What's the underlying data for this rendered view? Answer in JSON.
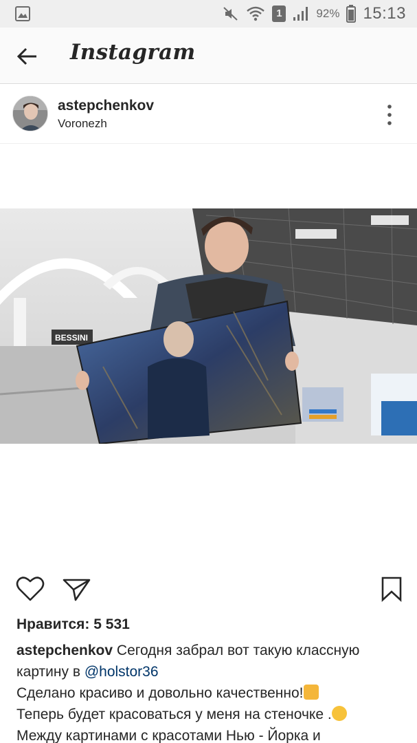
{
  "status_bar": {
    "battery_percent": "92%",
    "time": "15:13",
    "sim_badge": "1",
    "icons": [
      "gallery-notification-icon",
      "mute-icon",
      "wifi-icon",
      "sim-icon",
      "signal-icon",
      "battery-icon"
    ]
  },
  "header": {
    "title": "Instagram",
    "back_icon": "back-arrow-icon"
  },
  "post": {
    "username": "astepchenkov",
    "location": "Voronezh",
    "more_icon": "more-vertical-icon",
    "photo_store_sign": "BESSINI",
    "likes_label": "Нравится: 5 531",
    "caption": {
      "user": "astepchenkov",
      "line1_text": "Сегодня забрал вот такую классную",
      "line2_text": "картину в",
      "mention": "@holstor36",
      "line3_text": "Сделано красиво и довольно качественно!",
      "line3_emoji": "thumbs-up-emoji",
      "line4_text": "Теперь будет красоваться у меня на стеночке .",
      "line4_emoji": "smiling-face-emoji",
      "line5_text": "Между картинами с красотами Нью - Йорка и"
    },
    "action_icons": [
      "heart-icon",
      "share-icon",
      "bookmark-icon"
    ]
  },
  "colors": {
    "status_bar_bg": "#efefef",
    "header_bg": "#fafafa",
    "text": "#262626",
    "mention": "#003569"
  }
}
